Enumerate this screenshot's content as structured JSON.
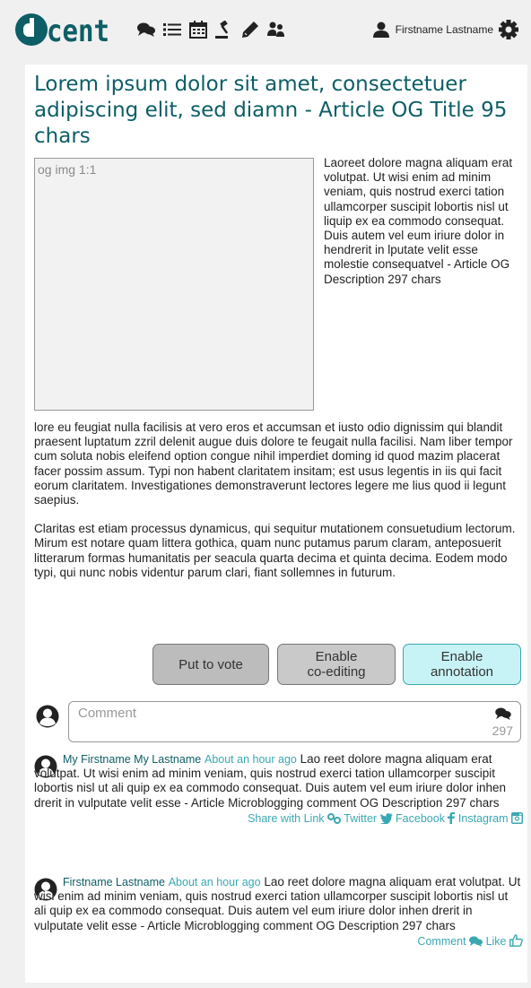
{
  "header": {
    "logo_text": "d-cent",
    "nav_icons": [
      "comments-icon",
      "list-icon",
      "calendar-icon",
      "gavel-icon",
      "pencil-icon",
      "users-icon"
    ],
    "user_name": "Firstname Lastname"
  },
  "article": {
    "title": "Lorem ipsum dolor sit amet, consectetuer adipiscing elit, sed diamn - Article OG Title 95 chars",
    "og_image_label": "og img 1:1",
    "og_description": "Laoreet dolore magna aliquam erat volutpat. Ut wisi enim ad minim veniam, quis nostrud exerci tation\n ullamcorper suscipit lobortis nisl ut liquip ex ea commodo consequat. Duis autem vel eum iriure dolor in hendrerit in lputate velit esse molestie consequatvel - Article OG Description 297 chars",
    "paragraph_1": "lore eu feugiat nulla facilisis at vero eros et accumsan et iusto odio dignissim qui blandit praesent luptatum zzril delenit augue duis dolore te feugait nulla facilisi. Nam liber tempor cum soluta nobis eleifend option congue nihil imperdiet doming id quod mazim placerat facer possim assum. Typi non habent claritatem insitam; est usus legentis in iis qui facit eorum claritatem. Investigationes demonstraverunt lectores legere me lius quod ii legunt saepius.",
    "paragraph_2": "Claritas est etiam processus dynamicus, qui sequitur mutationem consuetudium lectorum. Mirum est notare quam littera gothica, quam nunc putamus parum claram, anteposuerit litterarum formas humanitatis per seacula quarta decima et quinta decima. Eodem modo typi, qui nunc nobis videntur parum clari, fiant sollemnes in futurum."
  },
  "actions": {
    "vote_label": "Put to vote",
    "coedit_label": "Enable\nco-editing",
    "annotate_label": "Enable\nannotation"
  },
  "comment_form": {
    "placeholder": "Comment",
    "char_count": "297"
  },
  "posts": [
    {
      "author": "My Firstname My Lastname",
      "time": "About an hour ago",
      "text": "Lao reet dolore magna aliquam erat volutpat. Ut wisi enim ad minim veniam, quis nostrud exerci tation ullamcorper suscipit lobortis nisl ut ali quip ex ea commodo consequat. Duis autem vel eum iriure dolor inhen drerit in vulputate velit esse - Article Microblogging comment OG Description 297 chars",
      "share_link": "Share with Link",
      "share_twitter": "Twitter",
      "share_facebook": "Facebook",
      "share_instagram": "Instagram"
    },
    {
      "author": "Firstname Lastname",
      "time": "About an hour ago",
      "text": "Lao reet dolore magna aliquam erat volutpat. Ut wisi enim ad minim veniam, quis nostrud exerci tation ullamcorper suscipit lobortis nisl ut ali quip ex ea commodo consequat. Duis autem vel eum iriure dolor inhen drerit in vulputate velit esse - Article Microblogging comment OG Description 297 chars",
      "comment_label": "Comment",
      "like_label": "Like"
    }
  ],
  "colors": {
    "brand_teal": "#0d5e66",
    "link_teal": "#3aa8b3",
    "annotate_bg": "#c8f3f6"
  }
}
